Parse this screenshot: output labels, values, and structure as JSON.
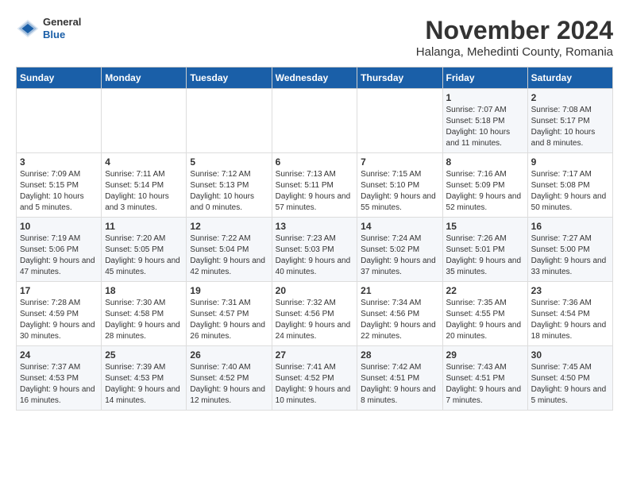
{
  "header": {
    "logo_general": "General",
    "logo_blue": "Blue",
    "title": "November 2024",
    "subtitle": "Halanga, Mehedinti County, Romania"
  },
  "days_of_week": [
    "Sunday",
    "Monday",
    "Tuesday",
    "Wednesday",
    "Thursday",
    "Friday",
    "Saturday"
  ],
  "weeks": [
    [
      {
        "day": "",
        "info": ""
      },
      {
        "day": "",
        "info": ""
      },
      {
        "day": "",
        "info": ""
      },
      {
        "day": "",
        "info": ""
      },
      {
        "day": "",
        "info": ""
      },
      {
        "day": "1",
        "info": "Sunrise: 7:07 AM\nSunset: 5:18 PM\nDaylight: 10 hours and 11 minutes."
      },
      {
        "day": "2",
        "info": "Sunrise: 7:08 AM\nSunset: 5:17 PM\nDaylight: 10 hours and 8 minutes."
      }
    ],
    [
      {
        "day": "3",
        "info": "Sunrise: 7:09 AM\nSunset: 5:15 PM\nDaylight: 10 hours and 5 minutes."
      },
      {
        "day": "4",
        "info": "Sunrise: 7:11 AM\nSunset: 5:14 PM\nDaylight: 10 hours and 3 minutes."
      },
      {
        "day": "5",
        "info": "Sunrise: 7:12 AM\nSunset: 5:13 PM\nDaylight: 10 hours and 0 minutes."
      },
      {
        "day": "6",
        "info": "Sunrise: 7:13 AM\nSunset: 5:11 PM\nDaylight: 9 hours and 57 minutes."
      },
      {
        "day": "7",
        "info": "Sunrise: 7:15 AM\nSunset: 5:10 PM\nDaylight: 9 hours and 55 minutes."
      },
      {
        "day": "8",
        "info": "Sunrise: 7:16 AM\nSunset: 5:09 PM\nDaylight: 9 hours and 52 minutes."
      },
      {
        "day": "9",
        "info": "Sunrise: 7:17 AM\nSunset: 5:08 PM\nDaylight: 9 hours and 50 minutes."
      }
    ],
    [
      {
        "day": "10",
        "info": "Sunrise: 7:19 AM\nSunset: 5:06 PM\nDaylight: 9 hours and 47 minutes."
      },
      {
        "day": "11",
        "info": "Sunrise: 7:20 AM\nSunset: 5:05 PM\nDaylight: 9 hours and 45 minutes."
      },
      {
        "day": "12",
        "info": "Sunrise: 7:22 AM\nSunset: 5:04 PM\nDaylight: 9 hours and 42 minutes."
      },
      {
        "day": "13",
        "info": "Sunrise: 7:23 AM\nSunset: 5:03 PM\nDaylight: 9 hours and 40 minutes."
      },
      {
        "day": "14",
        "info": "Sunrise: 7:24 AM\nSunset: 5:02 PM\nDaylight: 9 hours and 37 minutes."
      },
      {
        "day": "15",
        "info": "Sunrise: 7:26 AM\nSunset: 5:01 PM\nDaylight: 9 hours and 35 minutes."
      },
      {
        "day": "16",
        "info": "Sunrise: 7:27 AM\nSunset: 5:00 PM\nDaylight: 9 hours and 33 minutes."
      }
    ],
    [
      {
        "day": "17",
        "info": "Sunrise: 7:28 AM\nSunset: 4:59 PM\nDaylight: 9 hours and 30 minutes."
      },
      {
        "day": "18",
        "info": "Sunrise: 7:30 AM\nSunset: 4:58 PM\nDaylight: 9 hours and 28 minutes."
      },
      {
        "day": "19",
        "info": "Sunrise: 7:31 AM\nSunset: 4:57 PM\nDaylight: 9 hours and 26 minutes."
      },
      {
        "day": "20",
        "info": "Sunrise: 7:32 AM\nSunset: 4:56 PM\nDaylight: 9 hours and 24 minutes."
      },
      {
        "day": "21",
        "info": "Sunrise: 7:34 AM\nSunset: 4:56 PM\nDaylight: 9 hours and 22 minutes."
      },
      {
        "day": "22",
        "info": "Sunrise: 7:35 AM\nSunset: 4:55 PM\nDaylight: 9 hours and 20 minutes."
      },
      {
        "day": "23",
        "info": "Sunrise: 7:36 AM\nSunset: 4:54 PM\nDaylight: 9 hours and 18 minutes."
      }
    ],
    [
      {
        "day": "24",
        "info": "Sunrise: 7:37 AM\nSunset: 4:53 PM\nDaylight: 9 hours and 16 minutes."
      },
      {
        "day": "25",
        "info": "Sunrise: 7:39 AM\nSunset: 4:53 PM\nDaylight: 9 hours and 14 minutes."
      },
      {
        "day": "26",
        "info": "Sunrise: 7:40 AM\nSunset: 4:52 PM\nDaylight: 9 hours and 12 minutes."
      },
      {
        "day": "27",
        "info": "Sunrise: 7:41 AM\nSunset: 4:52 PM\nDaylight: 9 hours and 10 minutes."
      },
      {
        "day": "28",
        "info": "Sunrise: 7:42 AM\nSunset: 4:51 PM\nDaylight: 9 hours and 8 minutes."
      },
      {
        "day": "29",
        "info": "Sunrise: 7:43 AM\nSunset: 4:51 PM\nDaylight: 9 hours and 7 minutes."
      },
      {
        "day": "30",
        "info": "Sunrise: 7:45 AM\nSunset: 4:50 PM\nDaylight: 9 hours and 5 minutes."
      }
    ]
  ]
}
